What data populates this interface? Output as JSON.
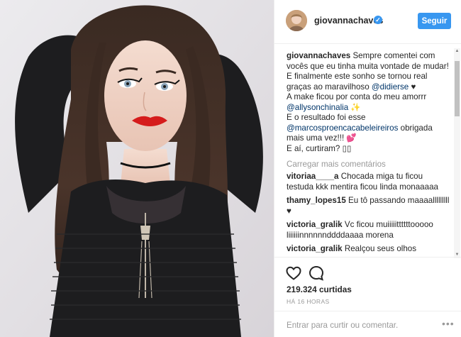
{
  "post": {
    "image_alt": "Foto de perfil"
  },
  "header": {
    "username": "giovannachaves",
    "verified_mark": "✓",
    "follow_label": "Seguir"
  },
  "caption": {
    "username": "giovannachaves",
    "line1": "Sempre comentei com vocês que eu tinha muita vontade de mudar! E finalmente este sonho se tornou real graças ao maravilhoso",
    "mention1": "@didierse",
    "line1_end": "♥",
    "line2": "A make ficou por conta do meu amorrr",
    "mention2": "@allysonchinalia",
    "line2_end": "✨",
    "line3": "E o resultado foi esse",
    "mention3": "@marcosproencacabeleireiros",
    "line3_end": "obrigada mais uma vez!!!",
    "line3_heart": "💕",
    "line4": "E aí, curtiram? ▯▯"
  },
  "load_more_label": "Carregar mais comentários",
  "comments": [
    {
      "user": "vitoriaa____a",
      "text": "Chocada miga tu ficou testuda kkk mentira ficou linda monaaaaa"
    },
    {
      "user": "thamy_lopes15",
      "text": "Eu tô passando maaaalllllllll ♥"
    },
    {
      "user": "victoria_gralik",
      "text": "Vc ficou muiiiiittttttooooo liiiiiinnnnnnddddaaaa morena"
    },
    {
      "user": "victoria_gralik",
      "text": "Realçou seus olhos"
    }
  ],
  "actions": {
    "like_icon": "heart-icon",
    "comment_icon": "comment-bubble-icon",
    "likes_count": "219.324",
    "likes_label": "curtidas",
    "time": "HÁ 16 HORAS"
  },
  "comment_box": {
    "placeholder": "Entrar para curtir ou comentar.",
    "more_label": "•••"
  },
  "colors": {
    "accent": "#3897f0",
    "mention": "#003569",
    "muted": "#999999",
    "text": "#262626"
  }
}
